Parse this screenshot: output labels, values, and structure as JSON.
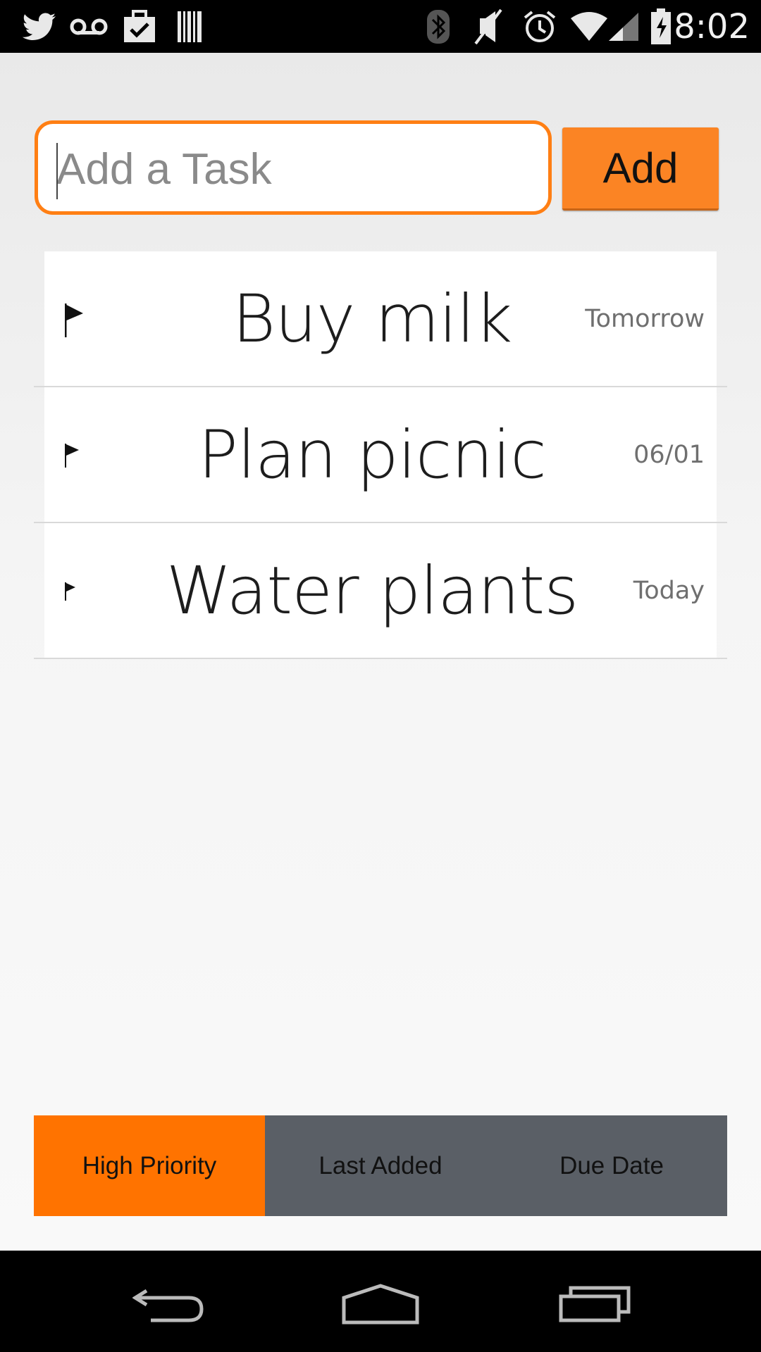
{
  "status_bar": {
    "time": "8:02",
    "left_icons": [
      "twitter-icon",
      "voicemail-icon",
      "bag-check-icon",
      "barcode-icon"
    ],
    "right_icons": [
      "bluetooth-icon",
      "mute-icon",
      "alarm-icon",
      "wifi-icon",
      "signal-icon",
      "battery-charging-icon"
    ]
  },
  "task_entry": {
    "placeholder": "Add a Task",
    "value": "",
    "add_label": "Add",
    "accent": "#ff7f14"
  },
  "tasks": [
    {
      "title": "Buy milk",
      "due": "Tomorrow",
      "priority_icon": "flag-icon"
    },
    {
      "title": "Plan picnic",
      "due": "06/01",
      "priority_icon": "flag-icon"
    },
    {
      "title": "Water plants",
      "due": "Today",
      "priority_icon": "flag-icon"
    }
  ],
  "sort_tabs": [
    {
      "label": "High Priority",
      "active": true
    },
    {
      "label": "Last Added",
      "active": false
    },
    {
      "label": "Due Date",
      "active": false
    }
  ],
  "colors": {
    "active_tab": "#ff7300",
    "inactive_tabs": "#5a5f66",
    "add_button": "#fb8424"
  },
  "nav_bar": {
    "buttons": [
      "back-icon",
      "home-icon",
      "recent-apps-icon"
    ]
  }
}
